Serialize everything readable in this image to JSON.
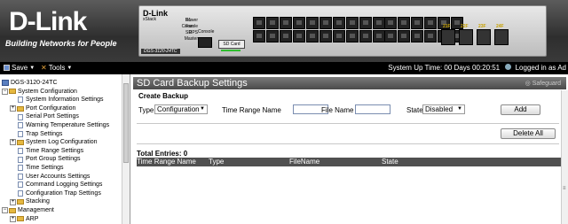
{
  "banner": {
    "logo": "D-Link",
    "tagline": "Building Networks for People",
    "device_brand": "D-Link",
    "device_sub": "xStack",
    "device_model": "DGS-3120-24TC",
    "leds": [
      "Power",
      "Console",
      "RPS",
      "Master"
    ],
    "unit_labels": [
      "S1",
      "Fan",
      "SD"
    ],
    "console_label": "Console",
    "sd_label": "SD Card",
    "sfp_labels": [
      "21F",
      "22F",
      "23F",
      "24F"
    ]
  },
  "toolbar": {
    "save": "Save",
    "tools": "Tools",
    "uptime": "System Up Time: 00 Days 00:20:51",
    "login": "Logged in as Ad"
  },
  "sidebar": {
    "items": [
      {
        "label": "DGS-3120-24TC",
        "indent": 0,
        "kind": "pc",
        "toggle": ""
      },
      {
        "label": "System Configuration",
        "indent": 0,
        "kind": "folder",
        "toggle": "−"
      },
      {
        "label": "System Information Settings",
        "indent": 2,
        "kind": "doc",
        "toggle": ""
      },
      {
        "label": "Port Configuration",
        "indent": 1,
        "kind": "folder",
        "toggle": "+"
      },
      {
        "label": "Serial Port Settings",
        "indent": 2,
        "kind": "doc",
        "toggle": ""
      },
      {
        "label": "Warning Temperature Settings",
        "indent": 2,
        "kind": "doc",
        "toggle": ""
      },
      {
        "label": "Trap Settings",
        "indent": 2,
        "kind": "doc",
        "toggle": ""
      },
      {
        "label": "System Log Configuration",
        "indent": 1,
        "kind": "folder",
        "toggle": "+"
      },
      {
        "label": "Time Range Settings",
        "indent": 2,
        "kind": "doc",
        "toggle": ""
      },
      {
        "label": "Port Group Settings",
        "indent": 2,
        "kind": "doc",
        "toggle": ""
      },
      {
        "label": "Time Settings",
        "indent": 2,
        "kind": "doc",
        "toggle": ""
      },
      {
        "label": "User Accounts Settings",
        "indent": 2,
        "kind": "doc",
        "toggle": ""
      },
      {
        "label": "Command Logging Settings",
        "indent": 2,
        "kind": "doc",
        "toggle": ""
      },
      {
        "label": "Configuration Trap Settings",
        "indent": 2,
        "kind": "doc",
        "toggle": ""
      },
      {
        "label": "Stacking",
        "indent": 1,
        "kind": "folder",
        "toggle": "+"
      },
      {
        "label": "Management",
        "indent": 0,
        "kind": "folder",
        "toggle": "−"
      },
      {
        "label": "ARP",
        "indent": 1,
        "kind": "folder",
        "toggle": "+"
      }
    ]
  },
  "main": {
    "title": "SD Card Backup Settings",
    "safeguard": "Safeguard",
    "section": "Create Backup",
    "type_label": "Type",
    "type_value": "Configuration",
    "time_range_label": "Time Range Name",
    "time_range_value": "",
    "file_name_label": "File Name",
    "file_name_value": "",
    "state_label": "State",
    "state_value": "Disabled",
    "add_button": "Add",
    "delete_all_button": "Delete All",
    "total_entries": "Total Entries: 0",
    "columns": [
      "Time Range Name",
      "Type",
      "FileName",
      "State"
    ]
  }
}
